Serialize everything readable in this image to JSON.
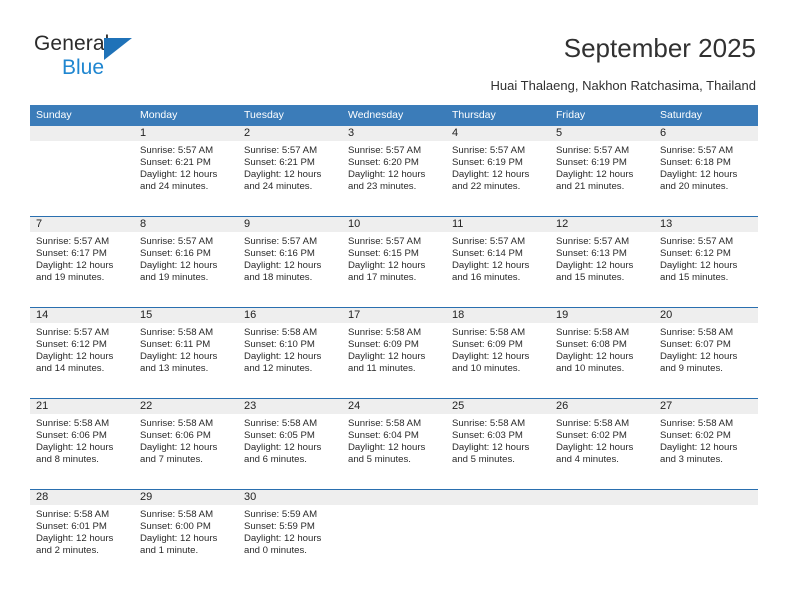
{
  "brand": {
    "name_top": "General",
    "name_bottom": "Blue"
  },
  "header": {
    "title": "September 2025",
    "subtitle": "Huai Thalaeng, Nakhon Ratchasima, Thailand"
  },
  "colors": {
    "header_blue": "#3b7cb9",
    "row_divider_blue": "#2a6faf",
    "daynum_band": "#eeeeee",
    "brand_blue": "#1f86d0"
  },
  "calendar": {
    "weekdays": [
      "Sunday",
      "Monday",
      "Tuesday",
      "Wednesday",
      "Thursday",
      "Friday",
      "Saturday"
    ],
    "weeks": [
      [
        {
          "day": "",
          "empty": true,
          "sunrise": "",
          "sunset": "",
          "daylight1": "",
          "daylight2": ""
        },
        {
          "day": "1",
          "sunrise": "Sunrise: 5:57 AM",
          "sunset": "Sunset: 6:21 PM",
          "daylight1": "Daylight: 12 hours",
          "daylight2": "and 24 minutes."
        },
        {
          "day": "2",
          "sunrise": "Sunrise: 5:57 AM",
          "sunset": "Sunset: 6:21 PM",
          "daylight1": "Daylight: 12 hours",
          "daylight2": "and 24 minutes."
        },
        {
          "day": "3",
          "sunrise": "Sunrise: 5:57 AM",
          "sunset": "Sunset: 6:20 PM",
          "daylight1": "Daylight: 12 hours",
          "daylight2": "and 23 minutes."
        },
        {
          "day": "4",
          "sunrise": "Sunrise: 5:57 AM",
          "sunset": "Sunset: 6:19 PM",
          "daylight1": "Daylight: 12 hours",
          "daylight2": "and 22 minutes."
        },
        {
          "day": "5",
          "sunrise": "Sunrise: 5:57 AM",
          "sunset": "Sunset: 6:19 PM",
          "daylight1": "Daylight: 12 hours",
          "daylight2": "and 21 minutes."
        },
        {
          "day": "6",
          "sunrise": "Sunrise: 5:57 AM",
          "sunset": "Sunset: 6:18 PM",
          "daylight1": "Daylight: 12 hours",
          "daylight2": "and 20 minutes."
        }
      ],
      [
        {
          "day": "7",
          "sunrise": "Sunrise: 5:57 AM",
          "sunset": "Sunset: 6:17 PM",
          "daylight1": "Daylight: 12 hours",
          "daylight2": "and 19 minutes."
        },
        {
          "day": "8",
          "sunrise": "Sunrise: 5:57 AM",
          "sunset": "Sunset: 6:16 PM",
          "daylight1": "Daylight: 12 hours",
          "daylight2": "and 19 minutes."
        },
        {
          "day": "9",
          "sunrise": "Sunrise: 5:57 AM",
          "sunset": "Sunset: 6:16 PM",
          "daylight1": "Daylight: 12 hours",
          "daylight2": "and 18 minutes."
        },
        {
          "day": "10",
          "sunrise": "Sunrise: 5:57 AM",
          "sunset": "Sunset: 6:15 PM",
          "daylight1": "Daylight: 12 hours",
          "daylight2": "and 17 minutes."
        },
        {
          "day": "11",
          "sunrise": "Sunrise: 5:57 AM",
          "sunset": "Sunset: 6:14 PM",
          "daylight1": "Daylight: 12 hours",
          "daylight2": "and 16 minutes."
        },
        {
          "day": "12",
          "sunrise": "Sunrise: 5:57 AM",
          "sunset": "Sunset: 6:13 PM",
          "daylight1": "Daylight: 12 hours",
          "daylight2": "and 15 minutes."
        },
        {
          "day": "13",
          "sunrise": "Sunrise: 5:57 AM",
          "sunset": "Sunset: 6:12 PM",
          "daylight1": "Daylight: 12 hours",
          "daylight2": "and 15 minutes."
        }
      ],
      [
        {
          "day": "14",
          "sunrise": "Sunrise: 5:57 AM",
          "sunset": "Sunset: 6:12 PM",
          "daylight1": "Daylight: 12 hours",
          "daylight2": "and 14 minutes."
        },
        {
          "day": "15",
          "sunrise": "Sunrise: 5:58 AM",
          "sunset": "Sunset: 6:11 PM",
          "daylight1": "Daylight: 12 hours",
          "daylight2": "and 13 minutes."
        },
        {
          "day": "16",
          "sunrise": "Sunrise: 5:58 AM",
          "sunset": "Sunset: 6:10 PM",
          "daylight1": "Daylight: 12 hours",
          "daylight2": "and 12 minutes."
        },
        {
          "day": "17",
          "sunrise": "Sunrise: 5:58 AM",
          "sunset": "Sunset: 6:09 PM",
          "daylight1": "Daylight: 12 hours",
          "daylight2": "and 11 minutes."
        },
        {
          "day": "18",
          "sunrise": "Sunrise: 5:58 AM",
          "sunset": "Sunset: 6:09 PM",
          "daylight1": "Daylight: 12 hours",
          "daylight2": "and 10 minutes."
        },
        {
          "day": "19",
          "sunrise": "Sunrise: 5:58 AM",
          "sunset": "Sunset: 6:08 PM",
          "daylight1": "Daylight: 12 hours",
          "daylight2": "and 10 minutes."
        },
        {
          "day": "20",
          "sunrise": "Sunrise: 5:58 AM",
          "sunset": "Sunset: 6:07 PM",
          "daylight1": "Daylight: 12 hours",
          "daylight2": "and 9 minutes."
        }
      ],
      [
        {
          "day": "21",
          "sunrise": "Sunrise: 5:58 AM",
          "sunset": "Sunset: 6:06 PM",
          "daylight1": "Daylight: 12 hours",
          "daylight2": "and 8 minutes."
        },
        {
          "day": "22",
          "sunrise": "Sunrise: 5:58 AM",
          "sunset": "Sunset: 6:06 PM",
          "daylight1": "Daylight: 12 hours",
          "daylight2": "and 7 minutes."
        },
        {
          "day": "23",
          "sunrise": "Sunrise: 5:58 AM",
          "sunset": "Sunset: 6:05 PM",
          "daylight1": "Daylight: 12 hours",
          "daylight2": "and 6 minutes."
        },
        {
          "day": "24",
          "sunrise": "Sunrise: 5:58 AM",
          "sunset": "Sunset: 6:04 PM",
          "daylight1": "Daylight: 12 hours",
          "daylight2": "and 5 minutes."
        },
        {
          "day": "25",
          "sunrise": "Sunrise: 5:58 AM",
          "sunset": "Sunset: 6:03 PM",
          "daylight1": "Daylight: 12 hours",
          "daylight2": "and 5 minutes."
        },
        {
          "day": "26",
          "sunrise": "Sunrise: 5:58 AM",
          "sunset": "Sunset: 6:02 PM",
          "daylight1": "Daylight: 12 hours",
          "daylight2": "and 4 minutes."
        },
        {
          "day": "27",
          "sunrise": "Sunrise: 5:58 AM",
          "sunset": "Sunset: 6:02 PM",
          "daylight1": "Daylight: 12 hours",
          "daylight2": "and 3 minutes."
        }
      ],
      [
        {
          "day": "28",
          "sunrise": "Sunrise: 5:58 AM",
          "sunset": "Sunset: 6:01 PM",
          "daylight1": "Daylight: 12 hours",
          "daylight2": "and 2 minutes."
        },
        {
          "day": "29",
          "sunrise": "Sunrise: 5:58 AM",
          "sunset": "Sunset: 6:00 PM",
          "daylight1": "Daylight: 12 hours",
          "daylight2": "and 1 minute."
        },
        {
          "day": "30",
          "sunrise": "Sunrise: 5:59 AM",
          "sunset": "Sunset: 5:59 PM",
          "daylight1": "Daylight: 12 hours",
          "daylight2": "and 0 minutes."
        },
        {
          "day": "",
          "empty": true,
          "sunrise": "",
          "sunset": "",
          "daylight1": "",
          "daylight2": ""
        },
        {
          "day": "",
          "empty": true,
          "sunrise": "",
          "sunset": "",
          "daylight1": "",
          "daylight2": ""
        },
        {
          "day": "",
          "empty": true,
          "sunrise": "",
          "sunset": "",
          "daylight1": "",
          "daylight2": ""
        },
        {
          "day": "",
          "empty": true,
          "sunrise": "",
          "sunset": "",
          "daylight1": "",
          "daylight2": ""
        }
      ]
    ]
  }
}
